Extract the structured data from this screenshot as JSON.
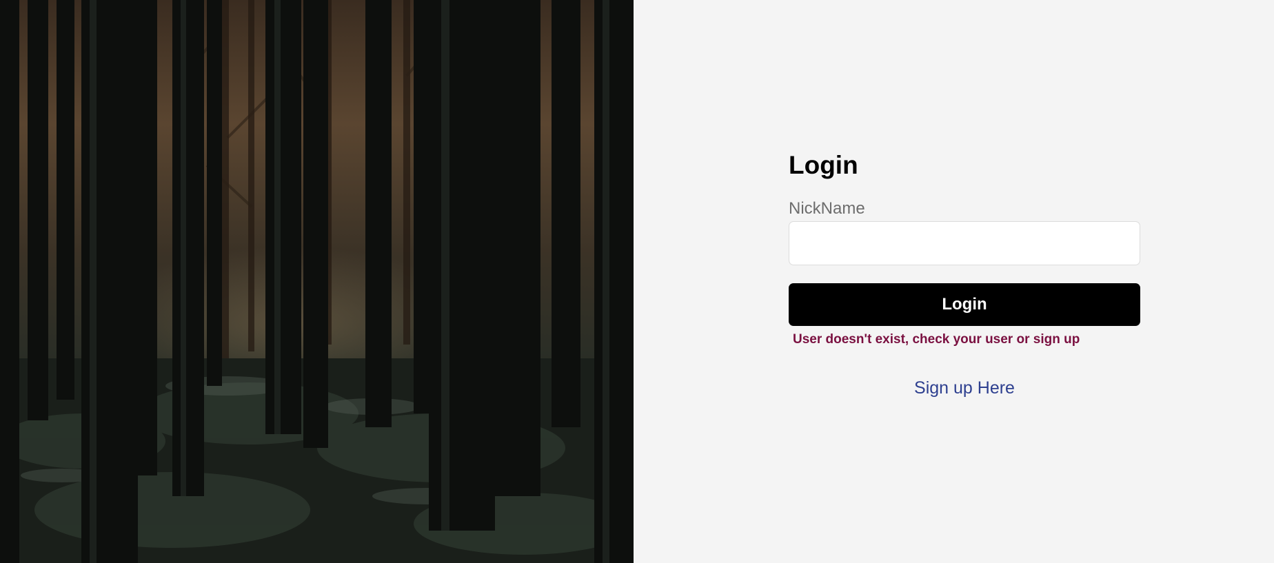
{
  "login": {
    "title": "Login",
    "nickname_label": "NickName",
    "nickname_value": "",
    "nickname_placeholder": "",
    "submit_label": "Login",
    "error_message": "User doesn't exist, check your user or sign up",
    "signup_link": "Sign up Here"
  },
  "colors": {
    "panel_background": "#f4f4f4",
    "button_background": "#000000",
    "error_text": "#7a1040",
    "link_text": "#2d3f8f"
  }
}
